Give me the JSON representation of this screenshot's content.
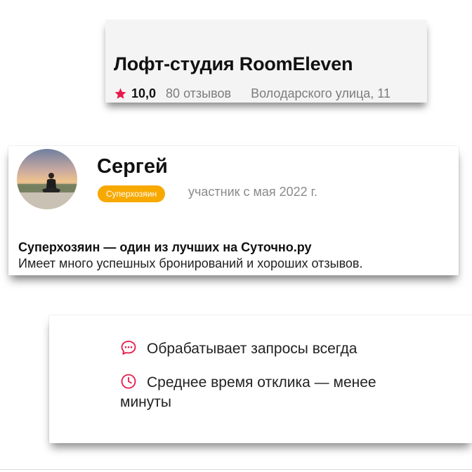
{
  "listing": {
    "title": "Лофт-студия RoomEleven",
    "rating": "10,0",
    "reviews": "80 отзывов",
    "address": "Володарского улица, 11",
    "star_color": "#e8194a"
  },
  "host": {
    "name": "Сергей",
    "badge": "Суперхозяин",
    "member_since": "участник с мая 2022 г.",
    "super_title": "Суперхозяин — один из лучших на Суточно.ру",
    "super_desc": "Имеет много успешных бронирований и хороших отзывов.",
    "badge_color": "#f8a900"
  },
  "response": {
    "requests_text": "Обрабатывает запросы всегда",
    "response_time_text": "Среднее время отклика — менее минуты",
    "icon_color": "#e8194a",
    "icons": [
      "chat-bubble-icon",
      "clock-icon"
    ]
  }
}
